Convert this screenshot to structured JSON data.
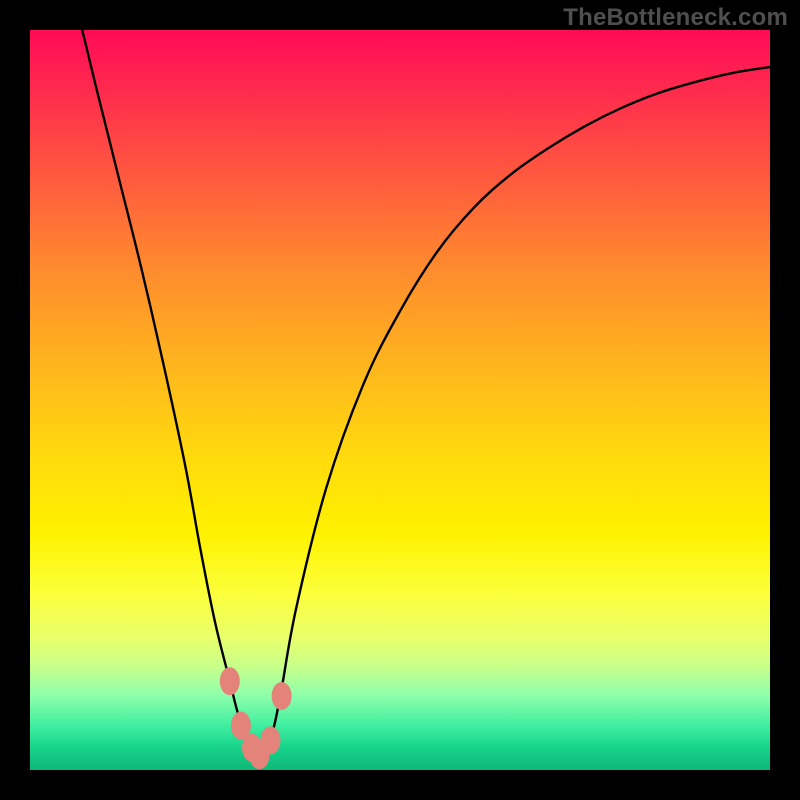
{
  "watermark": "TheBottleneck.com",
  "colors": {
    "gradient_top": "#ff0a57",
    "gradient_bottom": "#0fb877",
    "curve": "#000000",
    "marker": "#e38379",
    "frame_bg": "#000000",
    "watermark_text": "#4f4f4f"
  },
  "chart_data": {
    "type": "line",
    "title": "",
    "xlabel": "",
    "ylabel": "",
    "xlim": [
      0,
      100
    ],
    "ylim": [
      0,
      100
    ],
    "grid": false,
    "legend": false,
    "x": [
      3,
      6,
      9,
      12,
      15,
      18,
      21,
      23,
      25,
      27,
      28,
      29,
      30,
      31,
      32,
      33,
      34,
      36,
      40,
      45,
      50,
      55,
      60,
      65,
      70,
      75,
      80,
      85,
      90,
      95,
      100
    ],
    "y": [
      113,
      104,
      92,
      80,
      68,
      55,
      41,
      30,
      20,
      12,
      8,
      5,
      3,
      2,
      3,
      6,
      11,
      22,
      38,
      52,
      62,
      70,
      76,
      80.5,
      84,
      87,
      89.5,
      91.5,
      93,
      94.2,
      95
    ],
    "markers": [
      {
        "x": 27.0,
        "y": 12
      },
      {
        "x": 28.5,
        "y": 6
      },
      {
        "x": 30.0,
        "y": 3
      },
      {
        "x": 31.0,
        "y": 2
      },
      {
        "x": 32.5,
        "y": 4
      },
      {
        "x": 34.0,
        "y": 10
      }
    ],
    "note": "x is horizontal position in percent of plot width (0=left,100=right); y is value in percent (0=bottom of plot, 100=top). Curve extends above 100 at far left (clipped by frame)."
  }
}
